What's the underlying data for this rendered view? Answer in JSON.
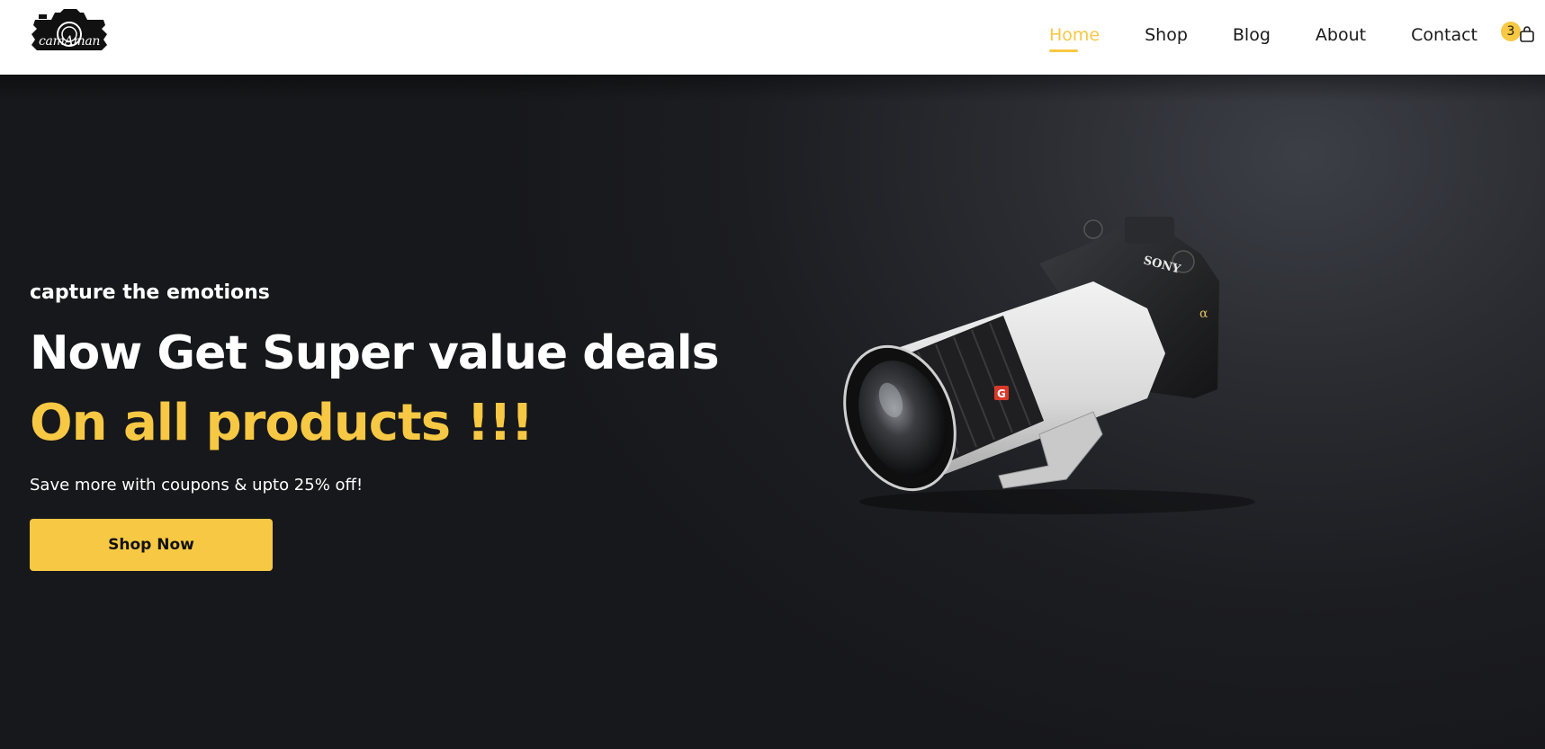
{
  "brand": {
    "logo_text": "camAman"
  },
  "nav": {
    "items": [
      {
        "label": "Home",
        "active": true
      },
      {
        "label": "Shop",
        "active": false
      },
      {
        "label": "Blog",
        "active": false
      },
      {
        "label": "About",
        "active": false
      },
      {
        "label": "Contact",
        "active": false
      }
    ]
  },
  "cart": {
    "count": "3",
    "icon": "shopping-bag-icon"
  },
  "hero": {
    "tagline": "capture the emotions",
    "headline": "Now Get Super value deals",
    "headline_accent": "On all products !!!",
    "subtext": "Save more with coupons & upto 25% off!",
    "cta_label": "Shop Now",
    "image": "camera-with-telephoto-lens",
    "camera_brand": "SONY"
  },
  "colors": {
    "accent": "#f7c843",
    "hero_bg": "#1c1d21",
    "header_bg": "#ffffff",
    "nav_text": "#1a1a1a"
  }
}
